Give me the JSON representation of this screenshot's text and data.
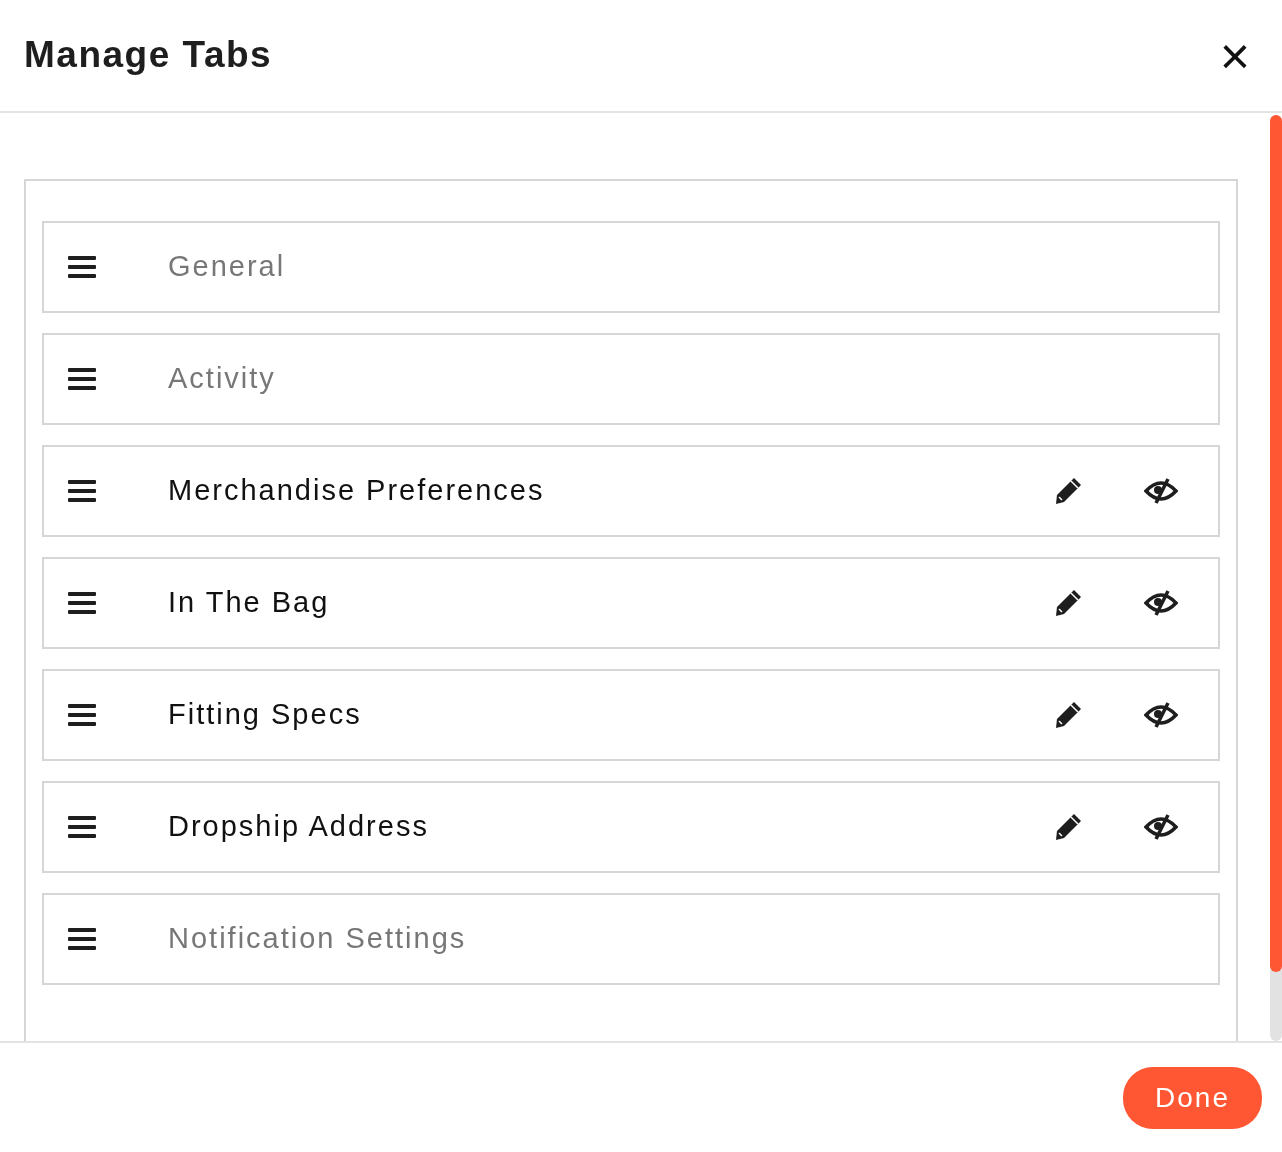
{
  "dialog": {
    "title": "Manage Tabs",
    "close": "×"
  },
  "tabs": [
    {
      "label": "General",
      "locked": true
    },
    {
      "label": "Activity",
      "locked": true
    },
    {
      "label": "Merchandise Preferences",
      "locked": false
    },
    {
      "label": "In The Bag",
      "locked": false
    },
    {
      "label": "Fitting Specs",
      "locked": false
    },
    {
      "label": "Dropship Address",
      "locked": false
    },
    {
      "label": "Notification Settings",
      "locked": true
    }
  ],
  "footer": {
    "done_button": "Done"
  }
}
